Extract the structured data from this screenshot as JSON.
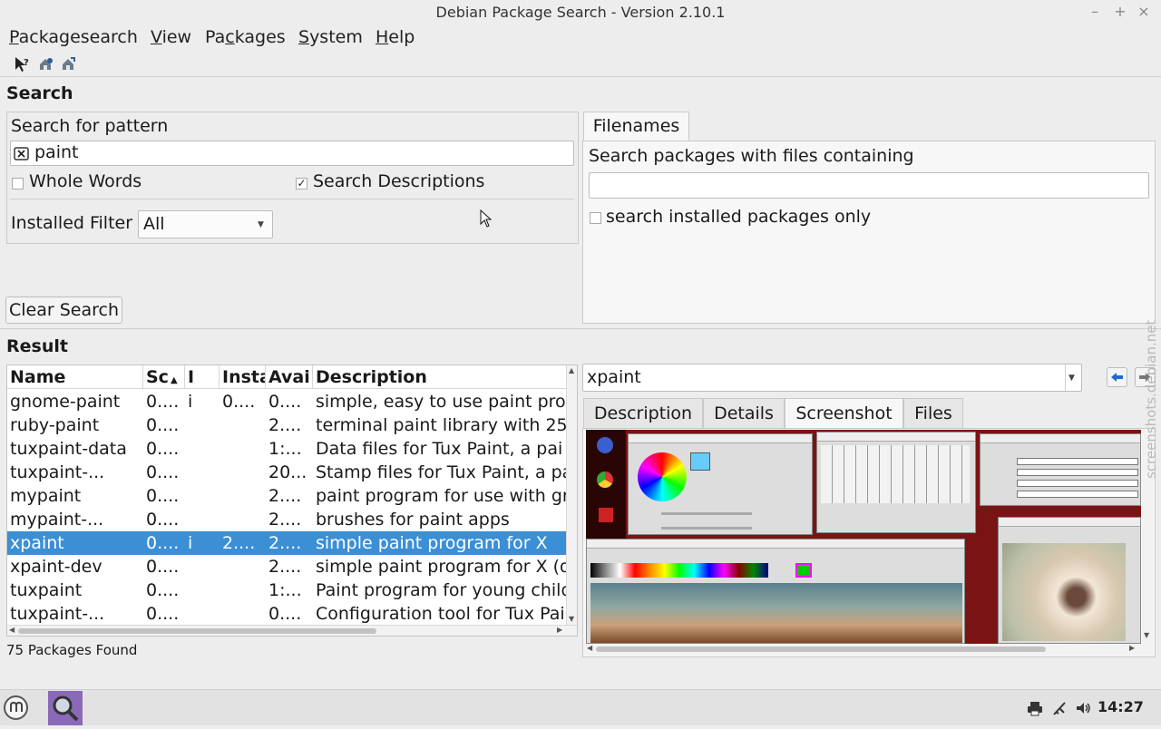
{
  "window": {
    "title": "Debian Package Search - Version 2.10.1"
  },
  "menubar": {
    "items": [
      {
        "accel": "P",
        "rest": "ackagesearch"
      },
      {
        "accel": "V",
        "rest": "iew"
      },
      {
        "pre": "Pa",
        "accel": "c",
        "rest": "kages"
      },
      {
        "accel": "S",
        "rest": "ystem"
      },
      {
        "accel": "H",
        "rest": "elp"
      }
    ]
  },
  "toolbar": {
    "icons": [
      "whats-this-icon",
      "update-package-list-icon",
      "install-package-icon"
    ]
  },
  "search": {
    "heading": "Search",
    "pattern_label": "Search for pattern",
    "pattern_value": "paint",
    "whole_words_label": "Whole Words",
    "whole_words_checked": false,
    "search_descriptions_label": "Search Descriptions",
    "search_descriptions_checked": true,
    "installed_filter_label": "Installed Filter",
    "installed_filter_value": "All",
    "clear_button": "Clear Search"
  },
  "filenames": {
    "tab_label": "Filenames",
    "prompt": "Search packages with files containing",
    "value": "",
    "installed_only_label": "search installed packages only",
    "installed_only_checked": false
  },
  "result": {
    "heading": "Result",
    "columns": [
      "Name",
      "Sc",
      "I",
      "Insta",
      "Avai",
      "Description"
    ],
    "rows": [
      {
        "name": "gnome-paint",
        "score": "0....",
        "installed": "i",
        "inst_ver": "0....",
        "avail_ver": "0....",
        "description": "simple, easy to use paint pro",
        "selected": false
      },
      {
        "name": "ruby-paint",
        "score": "0....",
        "installed": "",
        "inst_ver": "",
        "avail_ver": "2....",
        "description": "terminal paint library with 25",
        "selected": false
      },
      {
        "name": "tuxpaint-data",
        "score": "0....",
        "installed": "",
        "inst_ver": "",
        "avail_ver": "1:...",
        "description": "Data files for Tux Paint, a pai",
        "selected": false
      },
      {
        "name": "tuxpaint-...",
        "score": "0....",
        "installed": "",
        "inst_ver": "",
        "avail_ver": "20...",
        "description": "Stamp files for Tux Paint, a pa",
        "selected": false
      },
      {
        "name": "mypaint",
        "score": "0....",
        "installed": "",
        "inst_ver": "",
        "avail_ver": "2....",
        "description": "paint program for use with gr",
        "selected": false
      },
      {
        "name": "mypaint-...",
        "score": "0....",
        "installed": "",
        "inst_ver": "",
        "avail_ver": "2....",
        "description": "brushes for paint apps",
        "selected": false
      },
      {
        "name": "xpaint",
        "score": "0....",
        "installed": "i",
        "inst_ver": "2....",
        "avail_ver": "2....",
        "description": "simple paint program for X",
        "selected": true
      },
      {
        "name": "xpaint-dev",
        "score": "0....",
        "installed": "",
        "inst_ver": "",
        "avail_ver": "2....",
        "description": "simple paint program for X (d",
        "selected": false
      },
      {
        "name": "tuxpaint",
        "score": "0....",
        "installed": "",
        "inst_ver": "",
        "avail_ver": "1:...",
        "description": "Paint program for young child",
        "selected": false
      },
      {
        "name": "tuxpaint-...",
        "score": "0....",
        "installed": "",
        "inst_ver": "",
        "avail_ver": "0....",
        "description": "Configuration tool for Tux Pai",
        "selected": false
      }
    ],
    "status": "75 Packages Found"
  },
  "details": {
    "package_combo_value": "xpaint",
    "tabs": [
      "Description",
      "Details",
      "Screenshot",
      "Files"
    ],
    "active_tab": "Screenshot",
    "watermark": "screenshots.debian.net"
  },
  "taskbar": {
    "clock": "14:27"
  },
  "colors": {
    "selection": "#3b8fd4",
    "background": "#ededed"
  }
}
